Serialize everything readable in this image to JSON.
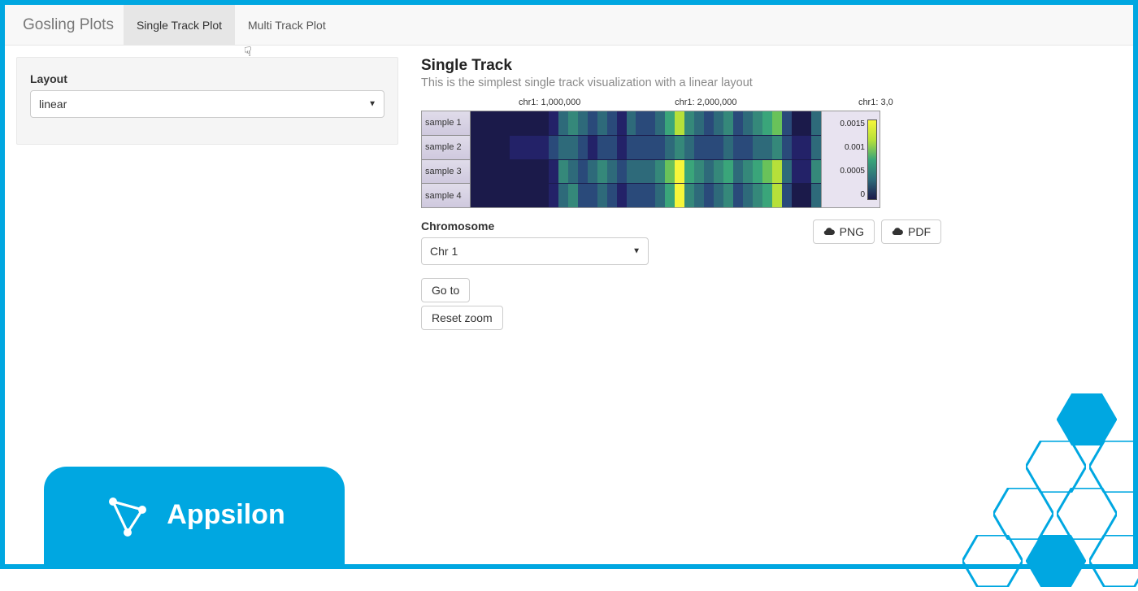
{
  "brand": "Gosling Plots",
  "tabs": [
    {
      "label": "Single Track Plot",
      "active": true
    },
    {
      "label": "Multi Track Plot",
      "active": false
    }
  ],
  "sidebar": {
    "layout_label": "Layout",
    "layout_value": "linear"
  },
  "main": {
    "title": "Single Track",
    "subtitle": "This is the simplest single track visualization with a linear layout",
    "chromosome_label": "Chromosome",
    "chromosome_value": "Chr 1",
    "goto_label": "Go to",
    "reset_label": "Reset zoom",
    "png_label": "PNG",
    "pdf_label": "PDF"
  },
  "chart_data": {
    "type": "heatmap",
    "title": "Single Track",
    "rows": [
      "sample 1",
      "sample 2",
      "sample 3",
      "sample 4"
    ],
    "x_ticks": [
      "chr1: 1,000,000",
      "chr1: 2,000,000",
      "chr1: 3,0"
    ],
    "x_tick_positions_pct": [
      28,
      62,
      99
    ],
    "legend_ticks": [
      "0.0015",
      "0.001",
      "0.0005",
      "0"
    ],
    "value_range": [
      0,
      0.0015
    ],
    "matrix_bins": [
      [
        0,
        0,
        0,
        0,
        0,
        0,
        0,
        0,
        1,
        3,
        4,
        3,
        2,
        3,
        2,
        1,
        3,
        2,
        2,
        3,
        5,
        7,
        4,
        3,
        2,
        3,
        4,
        2,
        3,
        4,
        5,
        6,
        2,
        0,
        0,
        3
      ],
      [
        0,
        0,
        0,
        0,
        1,
        1,
        1,
        1,
        2,
        3,
        3,
        2,
        1,
        2,
        2,
        1,
        2,
        2,
        2,
        2,
        3,
        4,
        3,
        2,
        2,
        2,
        3,
        2,
        2,
        3,
        3,
        4,
        2,
        1,
        1,
        3
      ],
      [
        0,
        0,
        0,
        0,
        0,
        0,
        0,
        0,
        1,
        4,
        3,
        2,
        3,
        4,
        3,
        2,
        3,
        3,
        3,
        4,
        6,
        8,
        5,
        4,
        3,
        4,
        5,
        3,
        4,
        5,
        6,
        7,
        3,
        1,
        1,
        4
      ],
      [
        0,
        0,
        0,
        0,
        0,
        0,
        0,
        0,
        1,
        3,
        4,
        2,
        2,
        3,
        2,
        1,
        2,
        2,
        2,
        3,
        5,
        8,
        4,
        3,
        2,
        3,
        4,
        2,
        3,
        4,
        5,
        7,
        2,
        0,
        0,
        3
      ]
    ]
  },
  "footer": {
    "brand": "Appsilon"
  }
}
